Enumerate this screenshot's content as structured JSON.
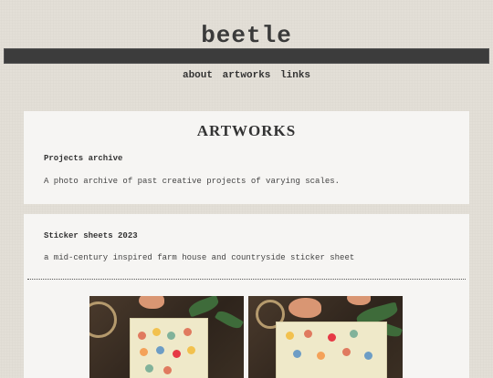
{
  "site": {
    "title": "beetle"
  },
  "nav": {
    "items": [
      "about",
      "artworks",
      "links"
    ]
  },
  "artworks": {
    "heading": "ARTWORKS",
    "projects": {
      "title": "Projects archive",
      "description": "A photo archive of past creative projects of varying scales."
    },
    "stickers": {
      "title": "Sticker sheets 2023",
      "description": "a mid-century inspired farm house and countryside sticker sheet"
    }
  },
  "images": [
    {
      "alt": "sticker sheet photo on wooden table"
    },
    {
      "alt": "sticker sheet photo close-up"
    }
  ],
  "colors": {
    "background": "#e3dfd7",
    "title_bar": "#3c3c3c",
    "card": "#f6f5f3",
    "text": "#333333"
  }
}
